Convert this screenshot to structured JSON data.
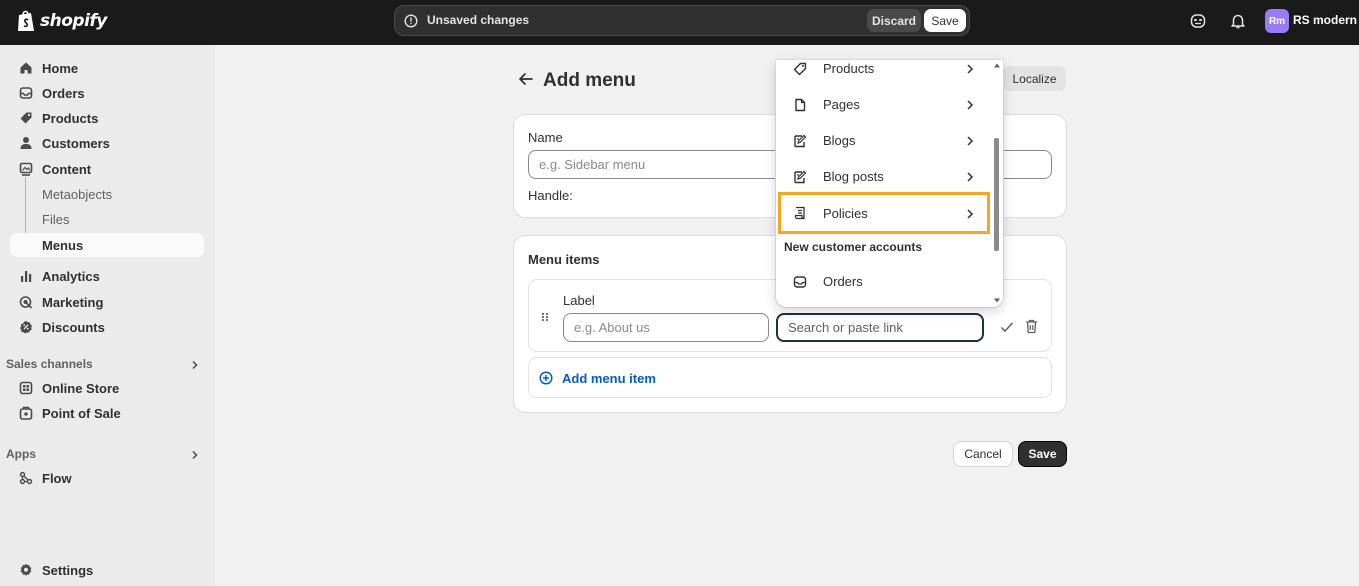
{
  "topbar": {
    "brand": "shopify",
    "unsaved_text": "Unsaved changes",
    "discard_label": "Discard",
    "save_label": "Save",
    "avatar_initials": "Rm",
    "store_name": "RS modern"
  },
  "sidebar": {
    "items": [
      {
        "label": "Home",
        "icon": "home-icon"
      },
      {
        "label": "Orders",
        "icon": "inbox-icon"
      },
      {
        "label": "Products",
        "icon": "tag-icon"
      },
      {
        "label": "Customers",
        "icon": "person-icon"
      },
      {
        "label": "Content",
        "icon": "content-icon"
      },
      {
        "label": "Metaobjects"
      },
      {
        "label": "Files"
      },
      {
        "label": "Menus"
      },
      {
        "label": "Analytics",
        "icon": "bar-chart-icon"
      },
      {
        "label": "Marketing",
        "icon": "target-icon"
      },
      {
        "label": "Discounts",
        "icon": "discount-icon"
      }
    ],
    "sales_channels_label": "Sales channels",
    "sales_channels": [
      {
        "label": "Online Store",
        "icon": "store-icon"
      },
      {
        "label": "Point of Sale",
        "icon": "pos-icon"
      }
    ],
    "apps_label": "Apps",
    "apps": [
      {
        "label": "Flow",
        "icon": "flow-icon"
      }
    ],
    "settings_label": "Settings"
  },
  "page": {
    "title": "Add menu",
    "localize_label": "Localize",
    "name_label": "Name",
    "name_placeholder": "e.g. Sidebar menu",
    "handle_label": "Handle:",
    "menu_items_heading": "Menu items",
    "item_label": "Label",
    "item_label_placeholder": "e.g. About us",
    "link_placeholder": "Search or paste link",
    "add_item_label": "Add menu item",
    "cancel_label": "Cancel",
    "save_label": "Save"
  },
  "dropdown": {
    "items": [
      {
        "label": "Products",
        "icon": "tag-icon"
      },
      {
        "label": "Pages",
        "icon": "page-icon"
      },
      {
        "label": "Blogs",
        "icon": "blog-icon"
      },
      {
        "label": "Blog posts",
        "icon": "blog-post-icon"
      },
      {
        "label": "Policies",
        "icon": "policy-icon"
      }
    ],
    "section_label": "New customer accounts",
    "section_items": [
      {
        "label": "Orders",
        "icon": "inbox-icon"
      }
    ]
  }
}
